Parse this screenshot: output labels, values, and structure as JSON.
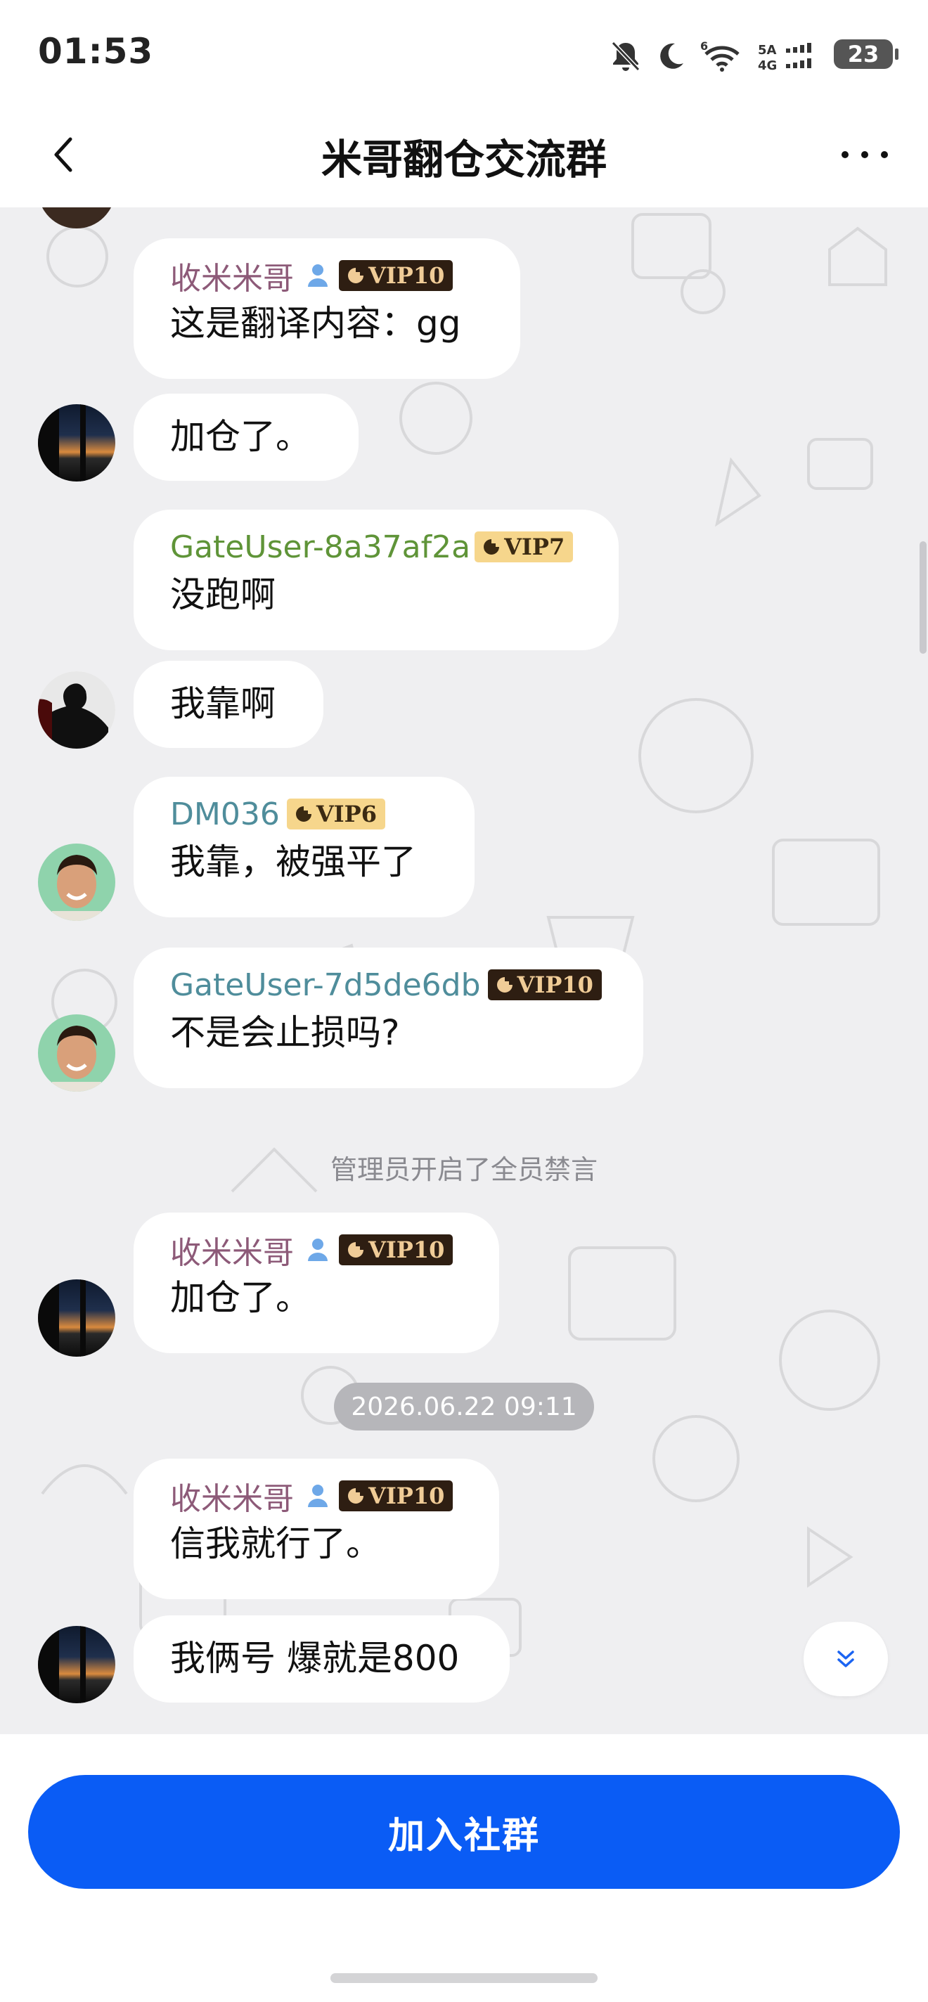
{
  "status_bar": {
    "time": "01:53",
    "network": "5A 4G",
    "battery": "23",
    "icons": [
      "bell-off-icon",
      "moon-icon",
      "wifi-6-icon",
      "signal-icon",
      "battery-icon"
    ]
  },
  "header": {
    "title": "米哥翻仓交流群",
    "back_icon": "chevron-left-icon",
    "more_icon": "more-dots-icon"
  },
  "messages": [
    {
      "sender": "收米米哥",
      "vip": "VIP10",
      "text": "这是翻译内容：gg",
      "color": "#8d5a78"
    },
    {
      "sender": "",
      "text": "加仓了。"
    },
    {
      "sender": "GateUser-8a37af2a",
      "vip": "VIP7",
      "text": "没跑啊",
      "color": "#5f9438"
    },
    {
      "sender": "",
      "text": "我靠啊"
    },
    {
      "sender": "DM036",
      "vip": "VIP6",
      "text": "我靠，被强平了",
      "color": "#4f8d9b"
    },
    {
      "sender": "GateUser-7d5de6db",
      "vip": "VIP10",
      "text": "不是会止损吗?",
      "color": "#4f8d9b"
    },
    {
      "system": "管理员开启了全员禁言"
    },
    {
      "sender": "收米米哥",
      "vip": "VIP10",
      "text": "加仓了。",
      "color": "#8d5a78"
    },
    {
      "timestamp": "2026.06.22 09:11"
    },
    {
      "sender": "收米米哥",
      "vip": "VIP10",
      "text": "信我就行了。",
      "color": "#8d5a78"
    },
    {
      "sender": "",
      "text": "我俩号 爆就是800"
    }
  ],
  "scroll_down_icon": "double-chevron-down-icon",
  "join_button": "加入社群",
  "colors": {
    "accent": "#0a5cf5",
    "vip_dark": "#2e1e12",
    "vip_gold": "#f6d68c",
    "chat_bg": "#efeff1"
  }
}
